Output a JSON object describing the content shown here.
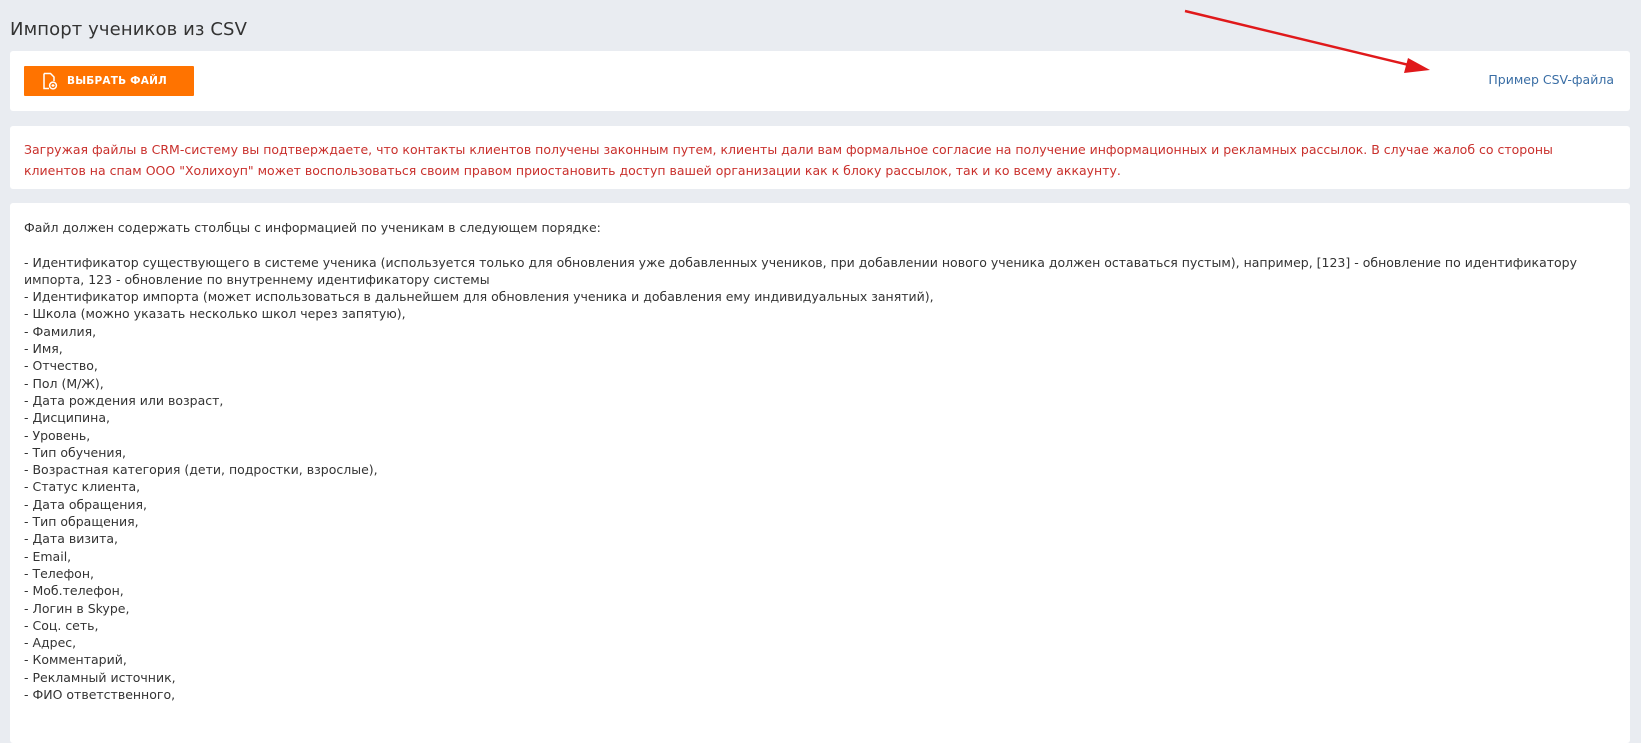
{
  "page": {
    "title": "Импорт учеников из CSV"
  },
  "upload": {
    "button_label": "ВЫБРАТЬ ФАЙЛ",
    "button_icon": "file-upload-icon",
    "sample_link": "Пример CSV-файла"
  },
  "warning": {
    "text": "Загружая файлы в CRM-систему вы подтверждаете, что контакты клиентов получены законным путем, клиенты дали вам формальное согласие на получение информационных и рекламных рассылок. В случае жалоб со стороны клиентов на спам ООО \"Холихоуп\" может воспользоваться своим правом приостановить доступ вашей организации как к блоку рассылок, так и ко всему аккаунту."
  },
  "info": {
    "intro": "Файл должен содержать столбцы с информацией по ученикам в следующем порядке:",
    "columns": [
      "- Идентификатор существующего в системе ученика (используется только для обновления уже добавленных учеников, при добавлении нового ученика должен оставаться пустым), например, [123] - обновление по идентификатору импорта, 123 - обновление по внутреннему идентификатору системы",
      "- Идентификатор импорта (может использоваться в дальнейшем для обновления ученика и добавления ему индивидуальных занятий),",
      "- Школа (можно указать несколько школ через запятую),",
      "- Фамилия,",
      "- Имя,",
      "- Отчество,",
      "- Пол (М/Ж),",
      "- Дата рождения или возраст,",
      "- Дисципина,",
      "- Уровень,",
      "- Тип обучения,",
      "- Возрастная категория (дети, подростки, взрослые),",
      "- Статус клиента,",
      "- Дата обращения,",
      "- Тип обращения,",
      "- Дата визита,",
      "- Email,",
      "- Телефон,",
      "- Моб.телефон,",
      "- Логин в Skype,",
      "- Соц. сеть,",
      "- Адрес,",
      "- Комментарий,",
      "- Рекламный источник,",
      "- ФИО ответственного,"
    ]
  },
  "colors": {
    "accent_button": "#ff7300",
    "link": "#3a6ea5",
    "warning_text": "#c9302c",
    "background": "#e9ecf1",
    "annotation_arrow": "#e0191b"
  }
}
